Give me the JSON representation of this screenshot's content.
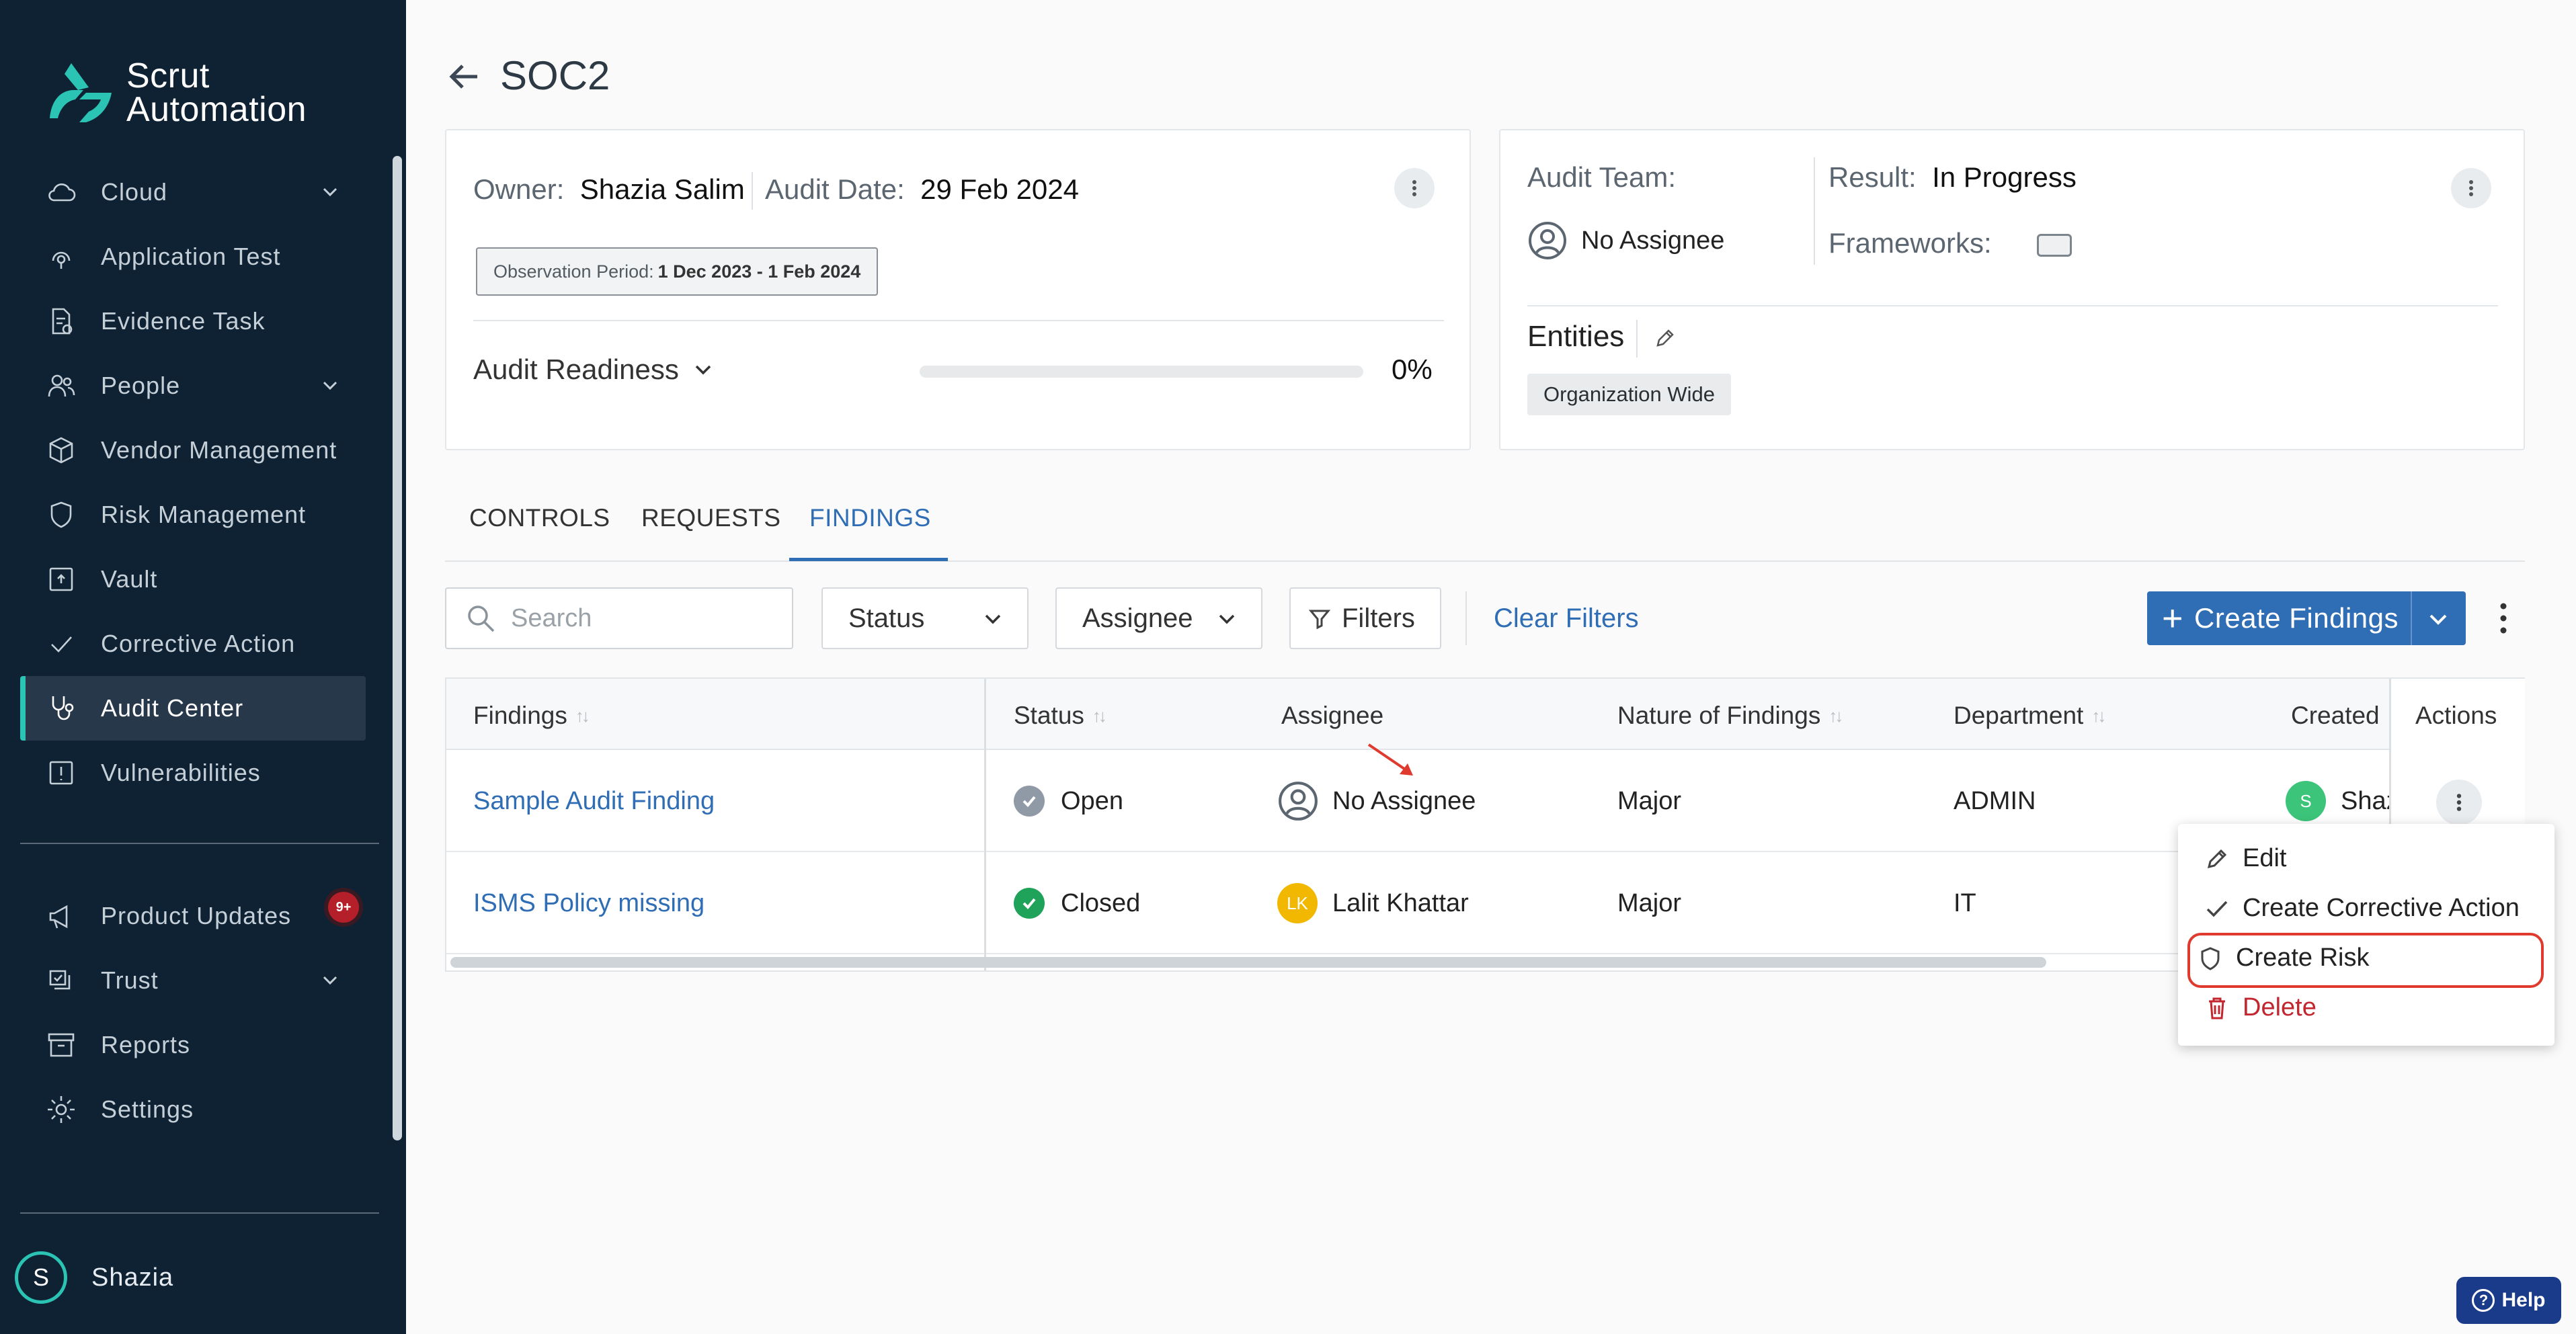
{
  "brand": {
    "line1": "Scrut",
    "line2": "Automation",
    "accent": "#2bc4b4"
  },
  "sidebar": {
    "items": [
      {
        "label": "Cloud",
        "icon": "cloud-icon",
        "expandable": true
      },
      {
        "label": "Application Test",
        "icon": "application-test-icon"
      },
      {
        "label": "Evidence Task",
        "icon": "evidence-task-icon"
      },
      {
        "label": "People",
        "icon": "people-icon",
        "expandable": true
      },
      {
        "label": "Vendor Management",
        "icon": "vendor-icon"
      },
      {
        "label": "Risk Management",
        "icon": "shield-icon"
      },
      {
        "label": "Vault",
        "icon": "vault-icon"
      },
      {
        "label": "Corrective Action",
        "icon": "check-icon"
      },
      {
        "label": "Audit Center",
        "icon": "stethoscope-icon",
        "active": true
      },
      {
        "label": "Vulnerabilities",
        "icon": "alert-icon"
      }
    ],
    "bottom_items": [
      {
        "label": "Product Updates",
        "icon": "megaphone-icon",
        "badge": "9+"
      },
      {
        "label": "Trust",
        "icon": "trust-icon",
        "expandable": true
      },
      {
        "label": "Reports",
        "icon": "archive-icon"
      },
      {
        "label": "Settings",
        "icon": "gear-icon"
      }
    ],
    "user": {
      "initial": "S",
      "name": "Shazia"
    }
  },
  "header": {
    "title": "SOC2"
  },
  "audit_info": {
    "owner_label": "Owner:",
    "owner": "Shazia Salim",
    "audit_date_label": "Audit Date:",
    "audit_date": "29 Feb 2024",
    "observation_label": "Observation Period:",
    "observation_value": "1 Dec 2023 - 1 Feb 2024",
    "readiness_label": "Audit Readiness",
    "readiness_percent": "0%",
    "readiness_fraction": 0
  },
  "audit_team": {
    "team_label": "Audit Team:",
    "assignee": "No Assignee",
    "result_label": "Result:",
    "result": "In Progress",
    "frameworks_label": "Frameworks:",
    "entities_label": "Entities",
    "entity_tag": "Organization Wide"
  },
  "tabs": [
    {
      "label": "CONTROLS"
    },
    {
      "label": "REQUESTS"
    },
    {
      "label": "FINDINGS",
      "active": true
    }
  ],
  "toolbar": {
    "search_placeholder": "Search",
    "status_label": "Status",
    "assignee_label": "Assignee",
    "filters_label": "Filters",
    "clear_label": "Clear Filters",
    "create_label": "Create Findings"
  },
  "table": {
    "columns": [
      "Findings",
      "Status",
      "Assignee",
      "Nature of Findings",
      "Department",
      "Created",
      "Actions"
    ],
    "rows": [
      {
        "finding": "Sample Audit Finding",
        "status": "Open",
        "status_color": "#8f9aa6",
        "assignee": "No Assignee",
        "nature": "Major",
        "department": "ADMIN",
        "created_initial": "S",
        "created_name": "Shaz",
        "created_color": "#3cc47a"
      },
      {
        "finding": "ISMS Policy missing",
        "status": "Closed",
        "status_color": "#1fa35a",
        "assignee_initials": "LK",
        "assignee": "Lalit Khattar",
        "assignee_color": "#f2b800",
        "nature": "Major",
        "department": "IT"
      }
    ]
  },
  "row_menu": {
    "items": [
      {
        "label": "Edit",
        "icon": "pencil-icon"
      },
      {
        "label": "Create Corrective Action",
        "icon": "check-icon"
      },
      {
        "label": "Create Risk",
        "icon": "shield-icon",
        "highlighted": true
      },
      {
        "label": "Delete",
        "icon": "trash-icon",
        "danger": true
      }
    ]
  },
  "help": {
    "label": "Help"
  }
}
